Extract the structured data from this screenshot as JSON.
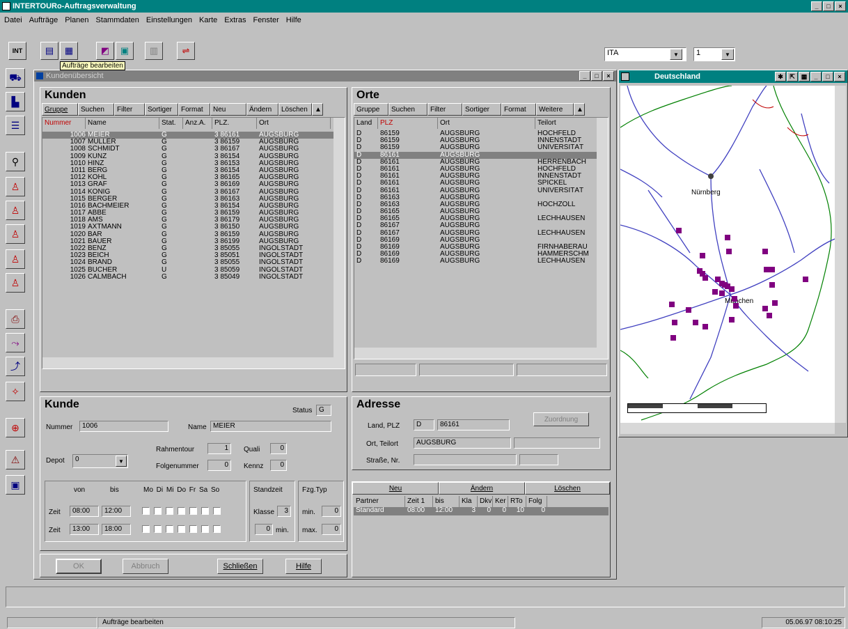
{
  "app": {
    "title": "INTERTOURo-Auftragsverwaltung"
  },
  "menu": [
    "Datei",
    "Aufträge",
    "Planen",
    "Stammdaten",
    "Einstellungen",
    "Karte",
    "Extras",
    "Fenster",
    "Hilfe"
  ],
  "toolbar": {
    "tooltip": "Aufträge bearbeiten",
    "lang_value": "ITA",
    "num_value": "1"
  },
  "child": {
    "title": "Kundenübersicht"
  },
  "kunden": {
    "title": "Kunden",
    "buttons": [
      "Gruppe",
      "Suchen",
      "Filter",
      "Sortiger",
      "Format",
      "Neu",
      "Ändern",
      "Löschen"
    ],
    "columns": [
      "Nummer",
      "Name",
      "Stat.",
      "Anz.A.",
      "PLZ.",
      "Ort"
    ],
    "rows": [
      [
        "1006",
        "MEIER",
        "G",
        "",
        "3 86161",
        "AUGSBURG"
      ],
      [
        "1007",
        "MÜLLER",
        "G",
        "",
        "3 86159",
        "AUGSBURG"
      ],
      [
        "1008",
        "SCHMIDT",
        "G",
        "",
        "3 86167",
        "AUGSBURG"
      ],
      [
        "1009",
        "KUNZ",
        "G",
        "",
        "3 86154",
        "AUGSBURG"
      ],
      [
        "1010",
        "HINZ",
        "G",
        "",
        "3 86153",
        "AUGSBURG"
      ],
      [
        "1011",
        "BERG",
        "G",
        "",
        "3 86154",
        "AUGSBURG"
      ],
      [
        "1012",
        "KOHL",
        "G",
        "",
        "3 86165",
        "AUGSBURG"
      ],
      [
        "1013",
        "GRAF",
        "G",
        "",
        "3 86169",
        "AUGSBURG"
      ],
      [
        "1014",
        "KÖNIG",
        "G",
        "",
        "3 86167",
        "AUGSBURG"
      ],
      [
        "1015",
        "BERGER",
        "G",
        "",
        "3 86163",
        "AUGSBURG"
      ],
      [
        "1016",
        "BACHMEIER",
        "G",
        "",
        "3 86154",
        "AUGSBURG"
      ],
      [
        "1017",
        "ABBE",
        "G",
        "",
        "3 86159",
        "AUGSBURG"
      ],
      [
        "1018",
        "AMS",
        "G",
        "",
        "3 86179",
        "AUGSBURG"
      ],
      [
        "1019",
        "AXTMANN",
        "G",
        "",
        "3 86150",
        "AUGSBURG"
      ],
      [
        "1020",
        "BAR",
        "G",
        "",
        "3 86159",
        "AUGSBURG"
      ],
      [
        "1021",
        "BAUER",
        "G",
        "",
        "3 86199",
        "AUGSBURG"
      ],
      [
        "1022",
        "BENZ",
        "G",
        "",
        "3 85055",
        "INGOLSTADT"
      ],
      [
        "1023",
        "BEICH",
        "G",
        "",
        "3 85051",
        "INGOLSTADT"
      ],
      [
        "1024",
        "BRAND",
        "G",
        "",
        "3 85055",
        "INGOLSTADT"
      ],
      [
        "1025",
        "BUCHER",
        "U",
        "",
        "3 85059",
        "INGOLSTADT"
      ],
      [
        "1026",
        "CALMBACH",
        "G",
        "",
        "3 85049",
        "INGOLSTADT"
      ]
    ]
  },
  "orte": {
    "title": "Orte",
    "buttons": [
      "Gruppe",
      "Suchen",
      "Filter",
      "Sortiger",
      "Format",
      "Weitere"
    ],
    "columns": [
      "Land",
      "PLZ",
      "Ort",
      "Teilort"
    ],
    "rows": [
      [
        "D",
        "86159",
        "AUGSBURG",
        "HOCHFELD"
      ],
      [
        "D",
        "86159",
        "AUGSBURG",
        "INNENSTADT"
      ],
      [
        "D",
        "86159",
        "AUGSBURG",
        "UNIVERSITÄT"
      ],
      [
        "D",
        "86161",
        "AUGSBURG",
        ""
      ],
      [
        "D",
        "86161",
        "AUGSBURG",
        "HERRENBACH"
      ],
      [
        "D",
        "86161",
        "AUGSBURG",
        "HOCHFELD"
      ],
      [
        "D",
        "86161",
        "AUGSBURG",
        "INNENSTADT"
      ],
      [
        "D",
        "86161",
        "AUGSBURG",
        "SPICKEL"
      ],
      [
        "D",
        "86161",
        "AUGSBURG",
        "UNIVERSITÄT"
      ],
      [
        "D",
        "86163",
        "AUGSBURG",
        ""
      ],
      [
        "D",
        "86163",
        "AUGSBURG",
        "HOCHZOLL"
      ],
      [
        "D",
        "86165",
        "AUGSBURG",
        ""
      ],
      [
        "D",
        "86165",
        "AUGSBURG",
        "LECHHAUSEN"
      ],
      [
        "D",
        "86167",
        "AUGSBURG",
        ""
      ],
      [
        "D",
        "86167",
        "AUGSBURG",
        "LECHHAUSEN"
      ],
      [
        "D",
        "86169",
        "AUGSBURG",
        ""
      ],
      [
        "D",
        "86169",
        "AUGSBURG",
        "FIRNHABERAU"
      ],
      [
        "D",
        "86169",
        "AUGSBURG",
        "HAMMERSCHM"
      ],
      [
        "D",
        "86169",
        "AUGSBURG",
        "LECHHAUSEN"
      ]
    ]
  },
  "kunde": {
    "title": "Kunde",
    "status_label": "Status",
    "status_value": "G",
    "nummer_label": "Nummer",
    "nummer_value": "1006",
    "name_label": "Name",
    "name_value": "MEIER",
    "depot_label": "Depot",
    "depot_value": "0",
    "rahmentour_label": "Rahmentour",
    "rahmentour_value": "1",
    "quali_label": "Quali",
    "quali_value": "0",
    "folgenummer_label": "Folgenummer",
    "folgenummer_value": "0",
    "kennz_label": "Kennz",
    "kennz_value": "0",
    "von_label": "von",
    "bis_label": "bis",
    "days_label": "Mo Di Mi Do Fr Sa So",
    "zeit_label": "Zeit",
    "zeit1_von": "08:00",
    "zeit1_bis": "12:00",
    "zeit2_von": "13:00",
    "zeit2_bis": "18:00",
    "standzeit_label": "Standzeit",
    "klasse_label": "Klasse",
    "klasse_value": "3",
    "min_value": "0",
    "min_unit": "min.",
    "fzgtyp_label": "Fzg.Typ",
    "fzg_min_label": "min.",
    "fzg_min_value": "0",
    "fzg_max_label": "max.",
    "fzg_max_value": "0",
    "footer_buttons": [
      "OK",
      "Abbruch",
      "Schließen",
      "Hilfe"
    ]
  },
  "adresse": {
    "title": "Adresse",
    "land_label": "Land, PLZ",
    "land_value": "D",
    "plz_value": "86161",
    "button": "Zuordnung",
    "ort_label": "Ort, Teilort",
    "ort_value": "AUGSBURG",
    "strasse_label": "Straße, Nr."
  },
  "partner": {
    "buttons": [
      "Neu",
      "Ändern",
      "Löschen"
    ],
    "columns": [
      "Partner",
      "Zeit 1",
      "bis",
      "Kla",
      "Dkv",
      "Ker",
      "RTo",
      "Folg"
    ],
    "row": [
      "Standard",
      "08:00",
      "12:00",
      "3",
      "0",
      "0",
      "10",
      "0"
    ]
  },
  "map": {
    "title": "Deutschland",
    "city1": "Nürnberg",
    "city2": "München"
  },
  "status": {
    "text": "Aufträge bearbeiten",
    "datetime": "05.06.97  08:10:25"
  },
  "colors": {
    "titlebar": "#0a246a",
    "map_title": "#008080",
    "marker": "#800080",
    "road": "#4040c0",
    "border": "#008000"
  }
}
